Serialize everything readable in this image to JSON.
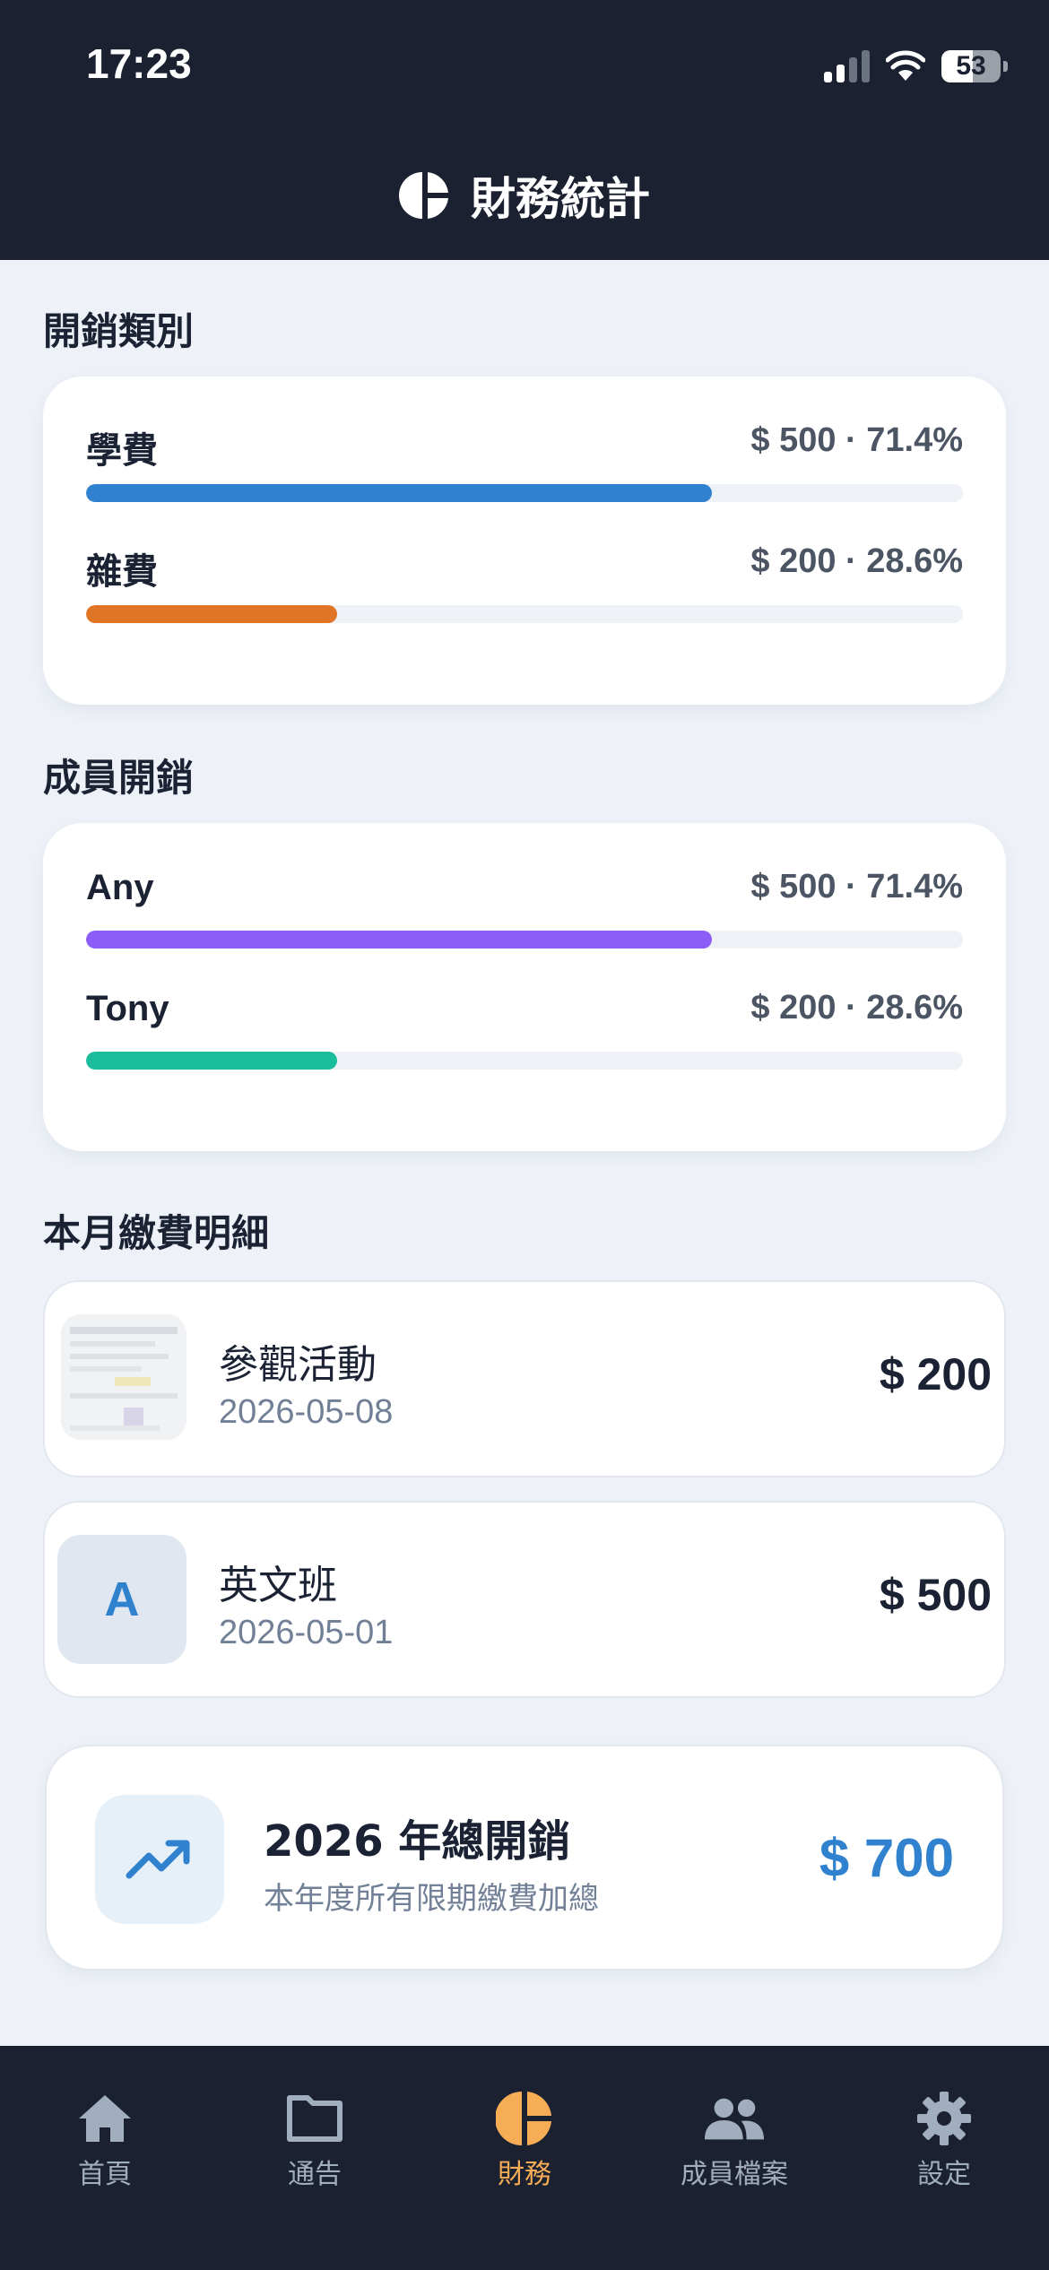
{
  "status_bar": {
    "time": "17:23",
    "battery": "53"
  },
  "header": {
    "title": "財務統計"
  },
  "category_section": {
    "title": "開銷類別",
    "items": [
      {
        "label": "學費",
        "value": "$ 500 · 71.4%",
        "percent": 71.4,
        "color": "#3182ce"
      },
      {
        "label": "雜費",
        "value": "$ 200 · 28.6%",
        "percent": 28.6,
        "color": "#e07526"
      }
    ]
  },
  "member_section": {
    "title": "成員開銷",
    "items": [
      {
        "label": "Any",
        "value": "$ 500 · 71.4%",
        "percent": 71.4,
        "color": "#8b5cf6"
      },
      {
        "label": "Tony",
        "value": "$ 200 · 28.6%",
        "percent": 28.6,
        "color": "#1abc9c"
      }
    ]
  },
  "payments_section": {
    "title": "本月繳費明細",
    "items": [
      {
        "name": "參觀活動",
        "date": "2026-05-08",
        "amount": "$ 200"
      },
      {
        "avatar_letter": "A",
        "name": "英文班",
        "date": "2026-05-01",
        "amount": "$ 500"
      }
    ]
  },
  "total": {
    "title": "2026 年總開銷",
    "subtitle": "本年度所有限期繳費加總",
    "amount": "$ 700"
  },
  "nav": {
    "items": [
      {
        "label": "首頁",
        "icon": "home-icon"
      },
      {
        "label": "通告",
        "icon": "folder-icon"
      },
      {
        "label": "財務",
        "icon": "pie-chart-icon",
        "active": true
      },
      {
        "label": "成員檔案",
        "icon": "people-icon"
      },
      {
        "label": "設定",
        "icon": "gear-icon"
      }
    ]
  },
  "colors": {
    "header_bg": "#1b2130",
    "accent": "#3182ce",
    "active_nav": "#f6ad55"
  }
}
